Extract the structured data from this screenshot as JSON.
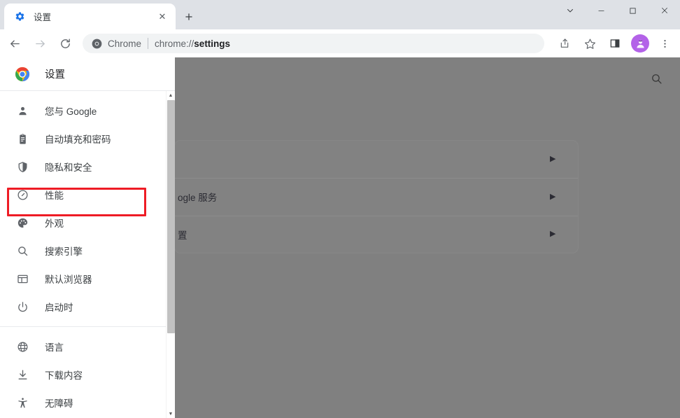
{
  "window": {
    "controls": {
      "tab_search_label": "⌄",
      "minimize_label": "—",
      "maximize_label": "▢",
      "close_label": "✕"
    }
  },
  "tabstrip": {
    "tab": {
      "title": "设置",
      "favicon": "gear-icon",
      "close_label": "✕"
    },
    "new_tab_label": "+"
  },
  "toolbar": {
    "back_label": "←",
    "forward_label": "→",
    "reload_label": "⟳",
    "omnibox": {
      "chip_text": "Chrome",
      "url_prefix": "chrome://",
      "url_bold": "settings"
    },
    "share_label": "share-icon",
    "bookmark_label": "star-icon",
    "side_panel_label": "side-panel-icon",
    "avatar_label": "profile-avatar",
    "menu_label": "⋮"
  },
  "sidebar": {
    "header": {
      "title": "设置",
      "logo": "chrome-logo"
    },
    "groups": [
      {
        "items": [
          {
            "label": "您与 Google",
            "icon": "person-icon",
            "highlighted": false
          },
          {
            "label": "自动填充和密码",
            "icon": "clipboard-icon",
            "highlighted": true
          },
          {
            "label": "隐私和安全",
            "icon": "shield-icon",
            "highlighted": false
          },
          {
            "label": "性能",
            "icon": "speedometer-icon",
            "highlighted": false
          },
          {
            "label": "外观",
            "icon": "palette-icon",
            "highlighted": false
          },
          {
            "label": "搜索引擎",
            "icon": "search-icon",
            "highlighted": false
          },
          {
            "label": "默认浏览器",
            "icon": "browser-window-icon",
            "highlighted": false
          },
          {
            "label": "启动时",
            "icon": "power-icon",
            "highlighted": false
          }
        ]
      },
      {
        "items": [
          {
            "label": "语言",
            "icon": "globe-icon",
            "highlighted": false
          },
          {
            "label": "下载内容",
            "icon": "download-icon",
            "highlighted": false
          },
          {
            "label": "无障碍",
            "icon": "accessibility-icon",
            "highlighted": false
          }
        ]
      }
    ],
    "scrollbar": {
      "up_arrow": "▲",
      "down_arrow": "▼"
    }
  },
  "content": {
    "search_icon": "search-icon",
    "card_rows": [
      {
        "label": "",
        "arrow": "▶"
      },
      {
        "label": "ogle 服务",
        "arrow": "▶"
      },
      {
        "label": "置",
        "arrow": "▶"
      }
    ]
  },
  "colors": {
    "accent_red": "#ee1c25",
    "avatar_purple": "#b362e8",
    "scrim_gray": "#808080",
    "tabstrip_gray": "#dee1e6"
  }
}
